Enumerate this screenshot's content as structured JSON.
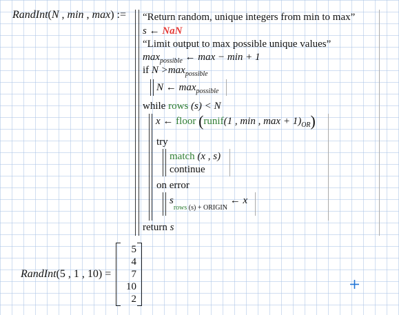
{
  "definition": {
    "func_name": "RandInt",
    "params": [
      "N",
      "min",
      "max"
    ],
    "assign": ":="
  },
  "program": {
    "comment1": "“Return random, unique integers from min to max”",
    "s_var": "s",
    "s_value": "NaN",
    "comment2": "“Limit output to max possible unique values”",
    "maxpossible_lhs": "max",
    "maxpossible_sub": "possible",
    "maxpossible_rhs": "max − min + 1",
    "if_kw": "if",
    "if_cond_lhs": "N >",
    "if_cond_rhs": "max",
    "if_body_lhs": "N ←",
    "while_kw": "while",
    "while_fn": "rows",
    "while_arg": "(s) < N",
    "x_assign": "x ←",
    "floor_fn": "floor",
    "runif_fn": "runif",
    "runif_args": "(1 , min , max + 1)",
    "or_sub": "OR",
    "try_kw": "try",
    "match_fn": "match",
    "match_args": "(x , s)",
    "continue_kw": "continue",
    "on_error_kw": "on error",
    "s_sub_fn": "rows",
    "s_sub_rest": "(s) + ORIGIN",
    "s_assign_rhs": "← x",
    "return_kw": "return",
    "return_var": "s"
  },
  "evaluation": {
    "call": "RandInt",
    "args": "(5 , 1 , 10)",
    "equals": "=",
    "result": [
      "5",
      "4",
      "7",
      "10",
      "2"
    ]
  },
  "cursor_icon": "crosshair-plus-icon",
  "colors": {
    "function": "#2e7d32",
    "nan": "#e53935",
    "cursor": "#1e73d6"
  }
}
